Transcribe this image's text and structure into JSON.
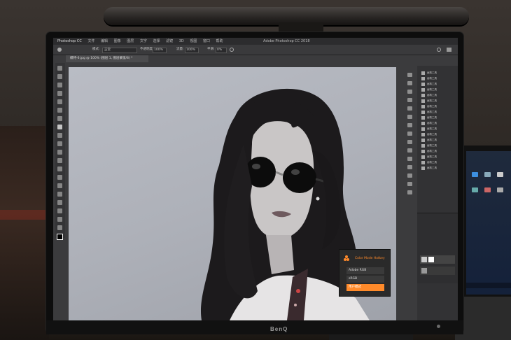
{
  "window": {
    "app_title": "Photoshop CC",
    "center_title": "Adobe Photoshop CC 2018",
    "document_tab": "模特-6.jpg @ 100% (图层 1, 图层蒙版/8) *"
  },
  "menu": [
    "文件",
    "编辑",
    "图像",
    "图层",
    "文字",
    "选择",
    "滤镜",
    "3D",
    "视图",
    "窗口",
    "帮助"
  ],
  "options_bar": {
    "mode_label": "模式:",
    "mode_value": "正常",
    "opacity_label": "不透明度:",
    "opacity_value": "100%",
    "flow_label": "流量:",
    "flow_value": "100%",
    "smooth_label": "平滑:",
    "smooth_value": "0%"
  },
  "history_items": [
    "画笔工具",
    "画笔工具",
    "画笔工具",
    "画笔工具",
    "画笔工具",
    "画笔工具",
    "画笔工具",
    "画笔工具",
    "画笔工具",
    "画笔工具",
    "画笔工具",
    "画笔工具",
    "画笔工具",
    "画笔工具",
    "画笔工具",
    "画笔工具",
    "画笔工具",
    "画笔工具"
  ],
  "color_mode_popup": {
    "title": "Color Mode Hotkey",
    "options": [
      "Adobe RGB",
      "sRGB",
      "用户模式"
    ],
    "selected_index": 2,
    "accent_color": "#ff8a2a"
  },
  "monitor": {
    "brand": "BenQ"
  },
  "icons": [
    "move-icon",
    "marquee-icon",
    "lasso-icon",
    "quick-select-icon",
    "crop-icon",
    "eyedropper-icon",
    "healing-icon",
    "brush-icon",
    "stamp-icon",
    "history-brush-icon",
    "eraser-icon",
    "gradient-icon",
    "blur-icon",
    "dodge-icon",
    "pen-icon",
    "type-icon",
    "path-select-icon",
    "shape-icon",
    "hand-icon",
    "zoom-icon"
  ]
}
